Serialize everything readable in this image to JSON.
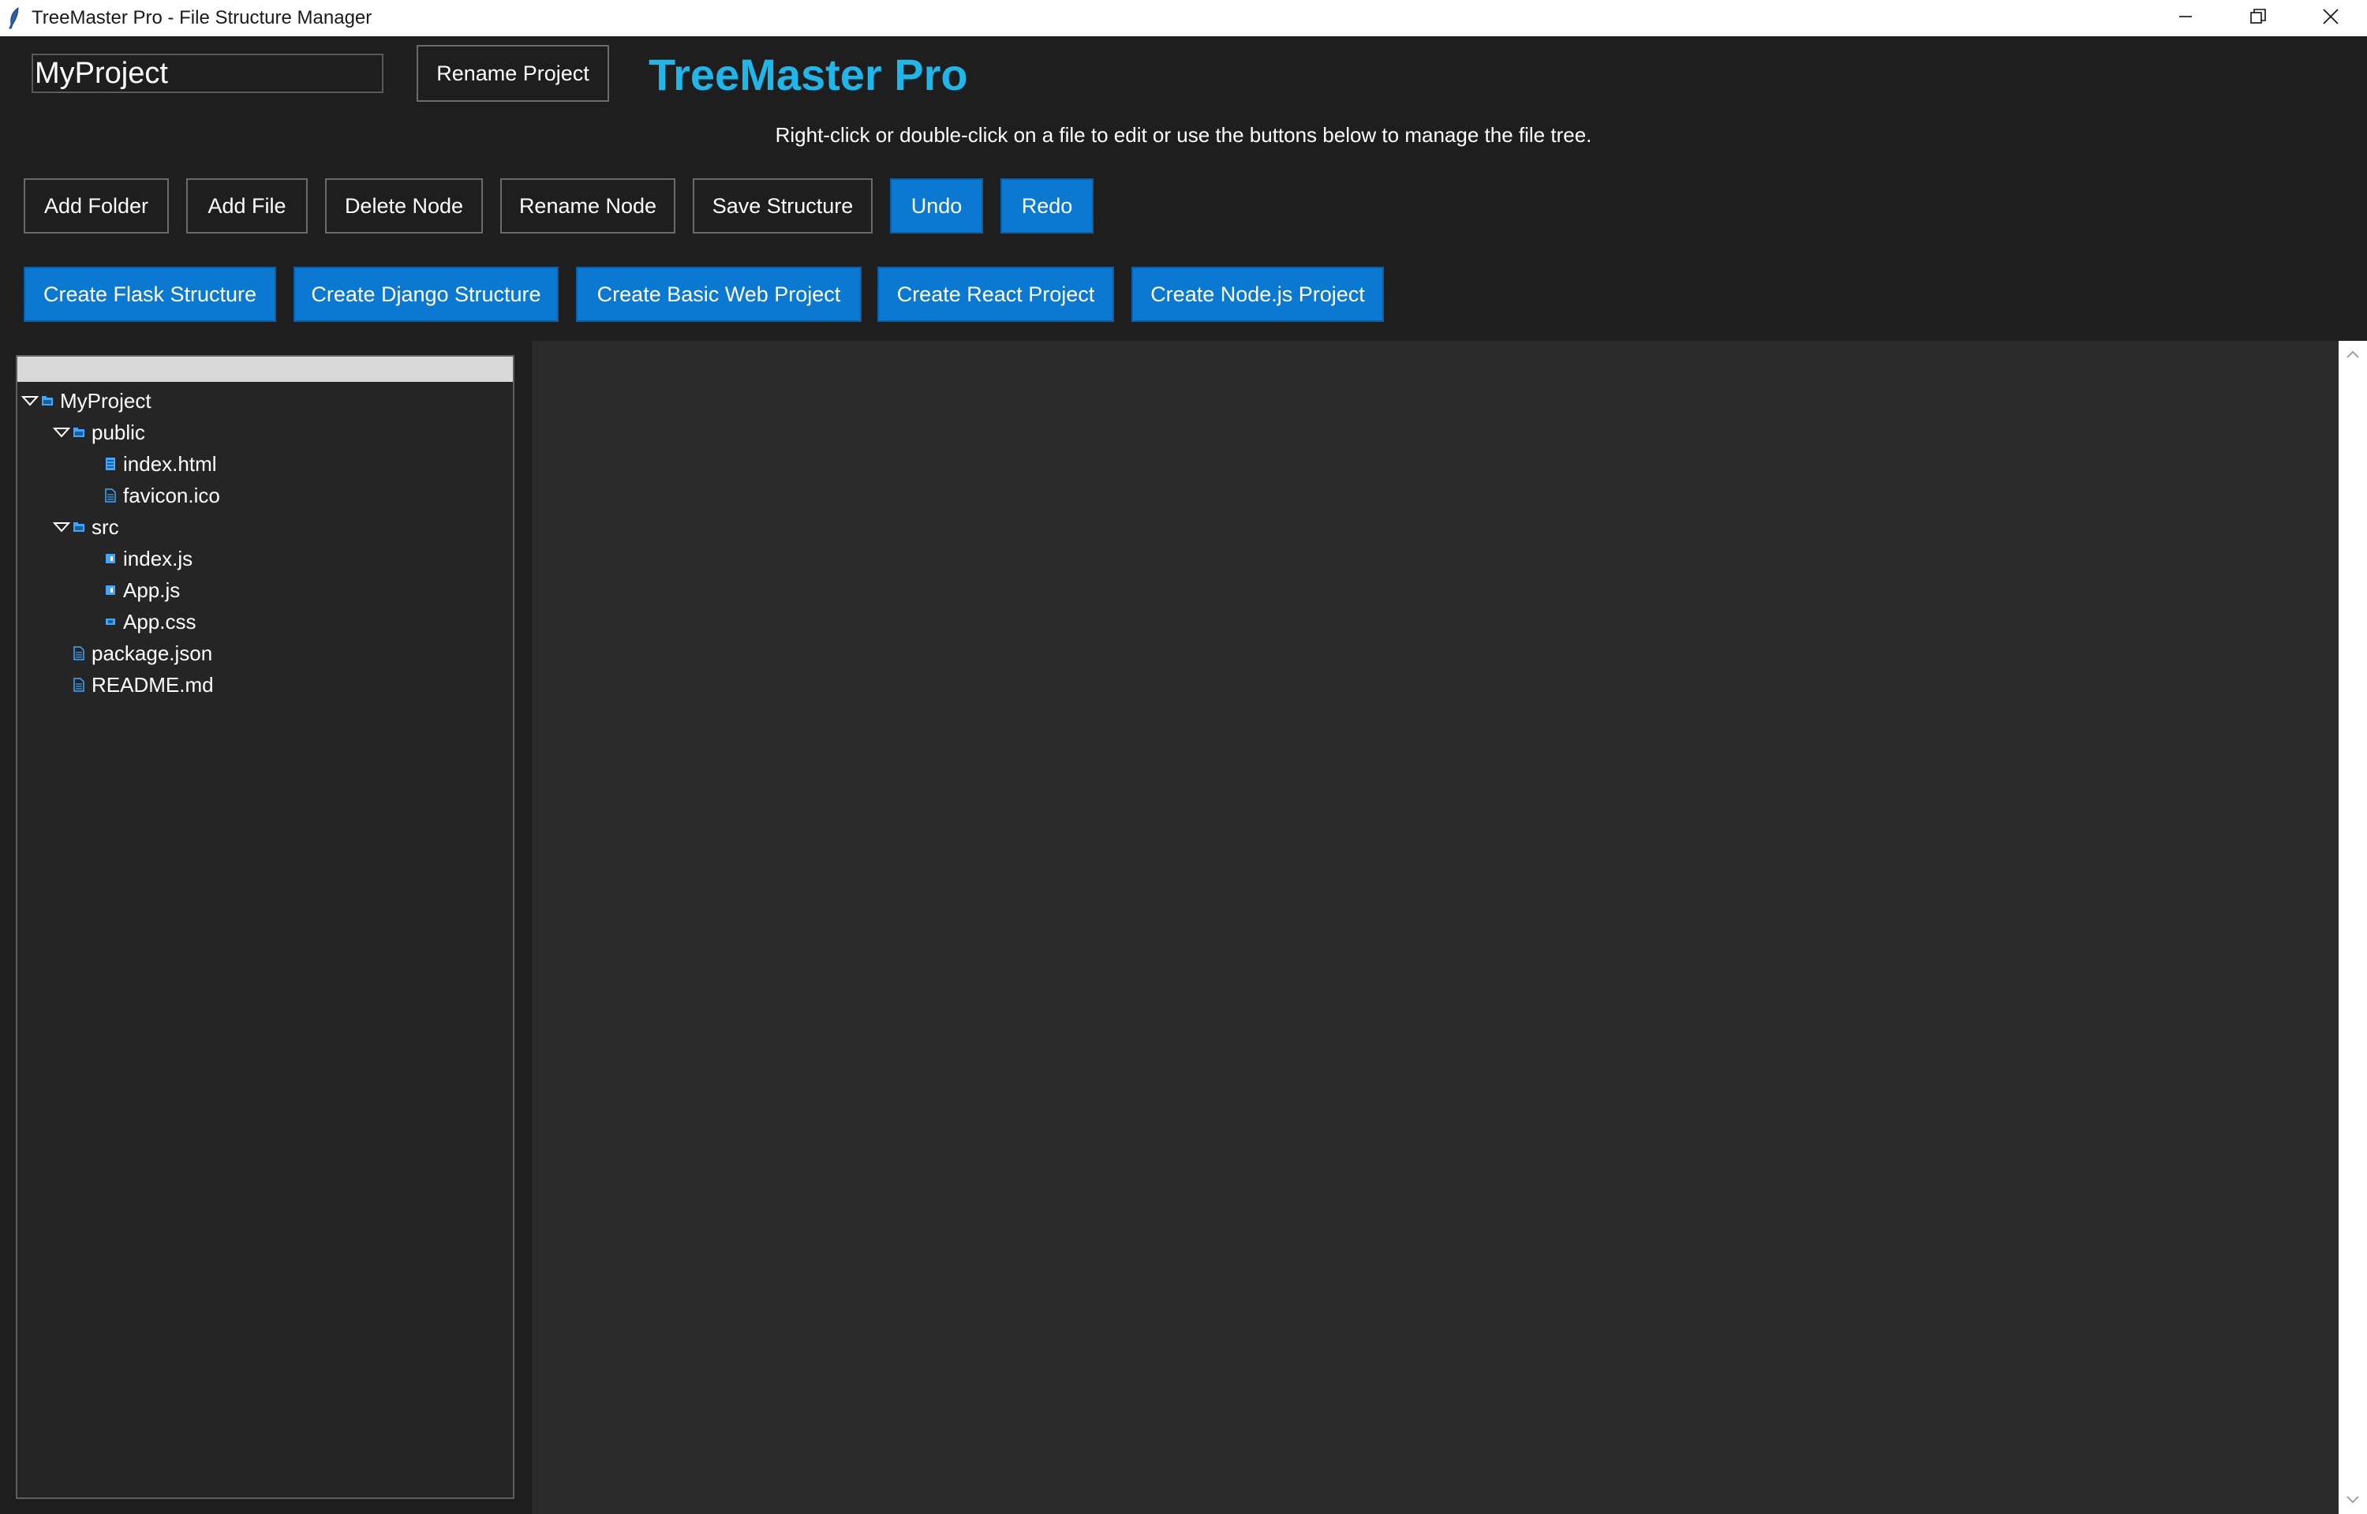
{
  "window": {
    "title": "TreeMaster Pro - File Structure Manager",
    "controls": [
      "minimize-icon",
      "restore-icon",
      "close-icon"
    ]
  },
  "project": {
    "name_value": "MyProject",
    "rename_label": "Rename Project"
  },
  "brand": {
    "title": "TreeMaster Pro",
    "color": "#1fb6ea"
  },
  "instructions": "Right-click or double-click on a file to edit or use the buttons below to manage the file tree.",
  "toolbar": {
    "add_folder": "Add Folder",
    "add_file": "Add File",
    "delete_node": "Delete Node",
    "rename_node": "Rename Node",
    "save_structure": "Save Structure",
    "undo": "Undo",
    "redo": "Redo"
  },
  "templates": {
    "flask": "Create Flask Structure",
    "django": "Create Django Structure",
    "basic_web": "Create Basic Web Project",
    "react": "Create React Project",
    "node": "Create Node.js Project"
  },
  "tree": {
    "items": [
      {
        "label": "MyProject",
        "type": "folder",
        "expanded": true,
        "depth": 0
      },
      {
        "label": "public",
        "type": "folder",
        "expanded": true,
        "depth": 1
      },
      {
        "label": "index.html",
        "type": "html-file",
        "depth": 2
      },
      {
        "label": "favicon.ico",
        "type": "file",
        "depth": 2
      },
      {
        "label": "src",
        "type": "folder",
        "expanded": true,
        "depth": 1
      },
      {
        "label": "index.js",
        "type": "js-file",
        "depth": 2
      },
      {
        "label": "App.js",
        "type": "js-file",
        "depth": 2
      },
      {
        "label": "App.css",
        "type": "css-file",
        "depth": 2
      },
      {
        "label": "package.json",
        "type": "file",
        "depth": 1
      },
      {
        "label": "README.md",
        "type": "file",
        "depth": 1
      }
    ]
  },
  "colors": {
    "accent_blue": "#0b78d1",
    "background": "#1e1e1e",
    "editor_bg": "#2b2b2b",
    "tree_bg": "#252525",
    "icon_blue": "#3ea6ff"
  }
}
